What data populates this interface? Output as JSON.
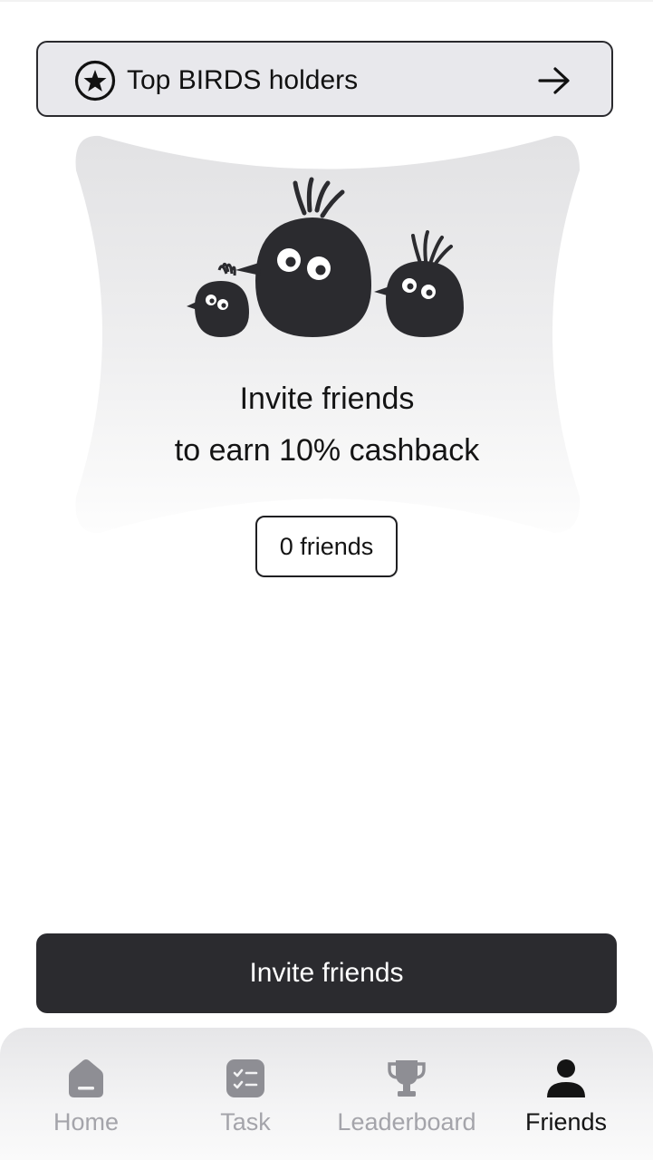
{
  "banner": {
    "label": "Top BIRDS holders",
    "icon": "star-icon",
    "action_icon": "arrow-right-icon"
  },
  "hero": {
    "line1": "Invite friends",
    "line2": "to earn 10% cashback"
  },
  "friends": {
    "count_label": "0 friends"
  },
  "invite_button": {
    "label": "Invite friends"
  },
  "nav": {
    "items": [
      {
        "label": "Home",
        "icon": "home-icon",
        "active": false
      },
      {
        "label": "Task",
        "icon": "task-list-icon",
        "active": false
      },
      {
        "label": "Leaderboard",
        "icon": "trophy-icon",
        "active": false
      },
      {
        "label": "Friends",
        "icon": "user-icon",
        "active": true
      }
    ]
  },
  "colors": {
    "primary_dark": "#2b2b2f",
    "inactive": "#a4a4aa",
    "banner_bg": "#e8e8ec"
  }
}
